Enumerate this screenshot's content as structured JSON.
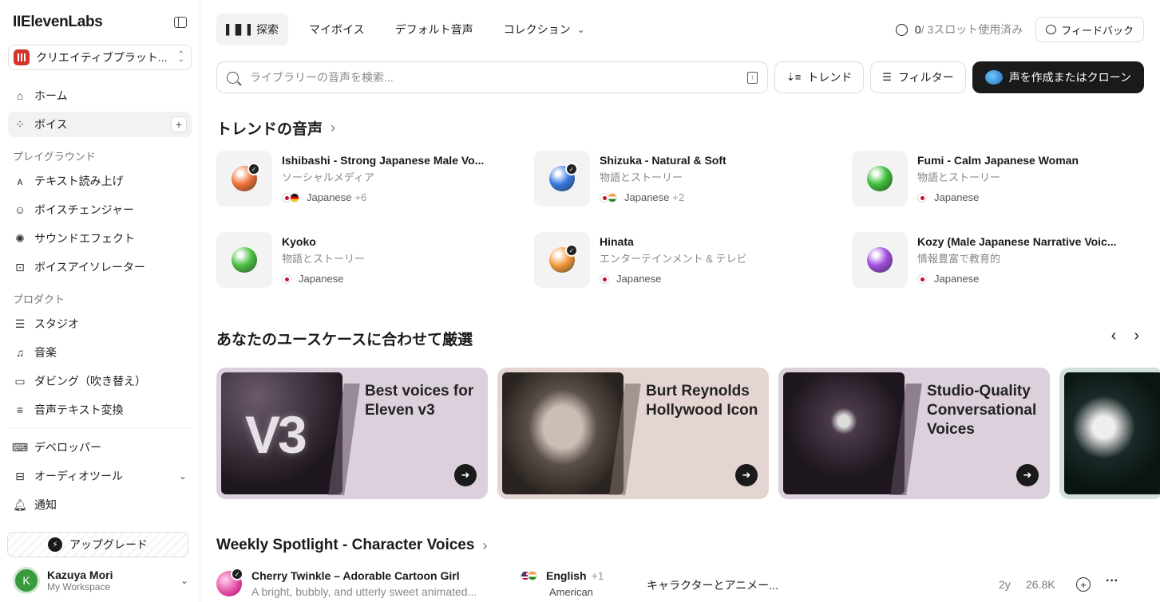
{
  "sidebar": {
    "logo": "IIElevenLabs",
    "workspace_label": "クリエイティブプラット...",
    "nav_main": [
      {
        "label": "ホーム",
        "icon": "home-icon"
      },
      {
        "label": "ボイス",
        "icon": "voices-icon"
      }
    ],
    "section_playground": "プレイグラウンド",
    "nav_playground": [
      {
        "label": "テキスト読み上げ"
      },
      {
        "label": "ボイスチェンジャー"
      },
      {
        "label": "サウンドエフェクト"
      },
      {
        "label": "ボイスアイソレーター"
      }
    ],
    "section_product": "プロダクト",
    "nav_product": [
      {
        "label": "スタジオ"
      },
      {
        "label": "音楽"
      },
      {
        "label": "ダビング（吹き替え）"
      },
      {
        "label": "音声テキスト変換"
      }
    ],
    "nav_bottom": [
      {
        "label": "デベロッパー"
      },
      {
        "label": "オーディオツール"
      },
      {
        "label": "通知"
      }
    ],
    "upgrade_label": "アップグレード",
    "user": {
      "initial": "K",
      "name": "Kazuya Mori",
      "workspace": "My Workspace"
    }
  },
  "topbar": {
    "tabs": [
      {
        "label": "探索"
      },
      {
        "label": "マイボイス"
      },
      {
        "label": "デフォルト音声"
      },
      {
        "label": "コレクション"
      }
    ],
    "slots_used": "0",
    "slots_total": "/ 3スロット使用済み",
    "feedback_label": "フィードバック"
  },
  "search": {
    "placeholder": "ライブラリーの音声を検索...",
    "trend_label": "トレンド",
    "filter_label": "フィルター",
    "create_label": "声を作成またはクローン"
  },
  "trending": {
    "title": "トレンドの音声",
    "voices": [
      {
        "name": "Ishibashi - Strong Japanese Male Vo...",
        "category": "ソーシャルメディア",
        "language": "Japanese",
        "more": "+6",
        "verified": true,
        "orb_color": "#f0743a"
      },
      {
        "name": "Shizuka - Natural & Soft",
        "category": "物語とストーリー",
        "language": "Japanese",
        "more": "+2",
        "verified": true,
        "orb_color": "#3a7ae0"
      },
      {
        "name": "Fumi - Calm Japanese Woman",
        "category": "物語とストーリー",
        "language": "Japanese",
        "more": "",
        "verified": false,
        "orb_color": "#3fbf3a"
      },
      {
        "name": "Kyoko",
        "category": "物語とストーリー",
        "language": "Japanese",
        "more": "",
        "verified": false,
        "orb_color": "#4cc043"
      },
      {
        "name": "Hinata",
        "category": "エンターテインメント & テレビ",
        "language": "Japanese",
        "more": "",
        "verified": true,
        "orb_color": "#f29a3c"
      },
      {
        "name": "Kozy (Male Japanese Narrative Voic...",
        "category": "情報豊富で教育的",
        "language": "Japanese",
        "more": "",
        "verified": false,
        "orb_color": "#a04ee0"
      }
    ]
  },
  "usecase": {
    "title": "あなたのユースケースに合わせて厳選",
    "collections": [
      {
        "title": "Best voices for Eleven v3",
        "image_text": "V3",
        "bg": "#dcd0dc"
      },
      {
        "title": "Burt Reynolds Hollywood Icon",
        "bg": "#e5d5d2"
      },
      {
        "title": "Studio-Quality Conversational Voices",
        "bg": "#dcd0dc"
      },
      {
        "title": "",
        "bg": "#d2e0dc"
      }
    ]
  },
  "spotlight": {
    "title": "Weekly Spotlight - Character Voices",
    "row": {
      "name": "Cherry Twinkle – Adorable Cartoon Girl",
      "description": "A bright, bubbly, and utterly sweet animated...",
      "language": "English",
      "more": "+1",
      "accent": "American",
      "category": "キャラクターとアニメー...",
      "age": "2y",
      "count": "26.8K"
    }
  }
}
